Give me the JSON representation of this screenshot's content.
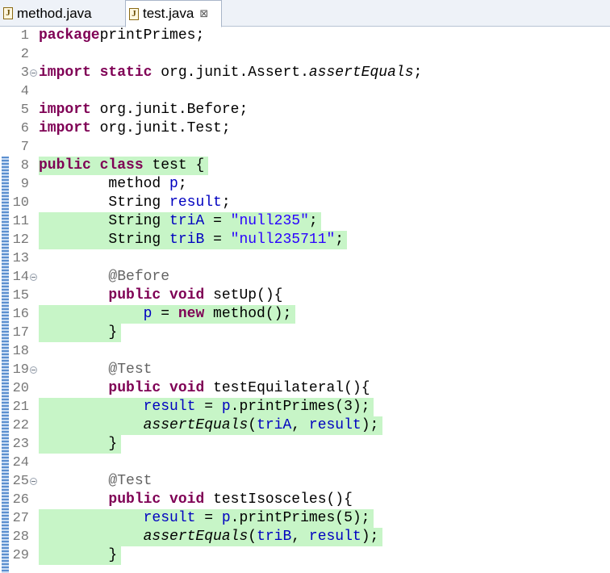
{
  "tabs": [
    {
      "label": "method.java",
      "active": false,
      "icon": "java-file-icon"
    },
    {
      "label": "test.java",
      "active": true,
      "icon": "java-file-icon"
    }
  ],
  "close_glyph": "⊠",
  "file_icon_glyph": "J",
  "colors": {
    "keyword": "#7f0055",
    "field": "#0000c0",
    "string": "#2a00ff",
    "annotation": "#646464",
    "covered_highlight": "#c7f5c7",
    "line_number": "#787878"
  },
  "code_lines": [
    {
      "n": "1",
      "indent": "",
      "fold": false,
      "covered": false,
      "tokens": [
        [
          "kw",
          "package"
        ],
        [
          "",
          "printPrimes;"
        ]
      ]
    },
    {
      "n": "2",
      "indent": "",
      "fold": false,
      "covered": false,
      "tokens": []
    },
    {
      "n": "3",
      "indent": "",
      "fold": true,
      "covered": false,
      "tokens": [
        [
          "kw",
          "import"
        ],
        [
          "",
          " "
        ],
        [
          "kw",
          "static"
        ],
        [
          "",
          " org.junit.Assert."
        ],
        [
          "st",
          "assertEquals"
        ],
        [
          "",
          ";"
        ]
      ]
    },
    {
      "n": "4",
      "indent": "",
      "fold": false,
      "covered": false,
      "tokens": []
    },
    {
      "n": "5",
      "indent": "",
      "fold": false,
      "covered": false,
      "tokens": [
        [
          "kw",
          "import"
        ],
        [
          "",
          " org.junit.Before;"
        ]
      ]
    },
    {
      "n": "6",
      "indent": "",
      "fold": false,
      "covered": false,
      "tokens": [
        [
          "kw",
          "import"
        ],
        [
          "",
          " org.junit.Test;"
        ]
      ]
    },
    {
      "n": "7",
      "indent": "",
      "fold": false,
      "covered": false,
      "tokens": []
    },
    {
      "n": "8",
      "indent": "",
      "fold": false,
      "covered": true,
      "tokens": [
        [
          "kw",
          "public"
        ],
        [
          "",
          " "
        ],
        [
          "kw",
          "class"
        ],
        [
          "",
          " test {"
        ]
      ]
    },
    {
      "n": "9",
      "indent": "        ",
      "fold": false,
      "covered": false,
      "tokens": [
        [
          "",
          "method "
        ],
        [
          "fld",
          "p"
        ],
        [
          "",
          ";"
        ]
      ]
    },
    {
      "n": "10",
      "indent": "        ",
      "fold": false,
      "covered": false,
      "tokens": [
        [
          "",
          "String "
        ],
        [
          "fld",
          "result"
        ],
        [
          "",
          ";"
        ]
      ]
    },
    {
      "n": "11",
      "indent": "        ",
      "fold": false,
      "covered": true,
      "tokens": [
        [
          "",
          "String "
        ],
        [
          "fld",
          "triA"
        ],
        [
          "",
          " = "
        ],
        [
          "str",
          "\"null235\""
        ],
        [
          "",
          ";"
        ]
      ]
    },
    {
      "n": "12",
      "indent": "        ",
      "fold": false,
      "covered": true,
      "tokens": [
        [
          "",
          "String "
        ],
        [
          "fld",
          "triB"
        ],
        [
          "",
          " = "
        ],
        [
          "str",
          "\"null235711\""
        ],
        [
          "",
          ";"
        ]
      ]
    },
    {
      "n": "13",
      "indent": "",
      "fold": false,
      "covered": false,
      "tokens": []
    },
    {
      "n": "14",
      "indent": "        ",
      "fold": true,
      "covered": false,
      "tokens": [
        [
          "ann",
          "@Before"
        ]
      ]
    },
    {
      "n": "15",
      "indent": "        ",
      "fold": false,
      "covered": false,
      "tokens": [
        [
          "kw",
          "public"
        ],
        [
          "",
          " "
        ],
        [
          "kw",
          "void"
        ],
        [
          "",
          " setUp(){"
        ]
      ]
    },
    {
      "n": "16",
      "indent": "            ",
      "fold": false,
      "covered": true,
      "tokens": [
        [
          "fld",
          "p"
        ],
        [
          "",
          " = "
        ],
        [
          "kw",
          "new"
        ],
        [
          "",
          " method();"
        ]
      ]
    },
    {
      "n": "17",
      "indent": "        ",
      "fold": false,
      "covered": true,
      "tokens": [
        [
          "",
          "}"
        ]
      ]
    },
    {
      "n": "18",
      "indent": "",
      "fold": false,
      "covered": false,
      "tokens": []
    },
    {
      "n": "19",
      "indent": "        ",
      "fold": true,
      "covered": false,
      "tokens": [
        [
          "ann",
          "@Test"
        ]
      ]
    },
    {
      "n": "20",
      "indent": "        ",
      "fold": false,
      "covered": false,
      "tokens": [
        [
          "kw",
          "public"
        ],
        [
          "",
          " "
        ],
        [
          "kw",
          "void"
        ],
        [
          "",
          " testEquilateral(){"
        ]
      ]
    },
    {
      "n": "21",
      "indent": "            ",
      "fold": false,
      "covered": true,
      "tokens": [
        [
          "fld",
          "result"
        ],
        [
          "",
          " = "
        ],
        [
          "fld",
          "p"
        ],
        [
          "",
          ".printPrimes(3);"
        ]
      ]
    },
    {
      "n": "22",
      "indent": "            ",
      "fold": false,
      "covered": true,
      "tokens": [
        [
          "st",
          "assertEquals"
        ],
        [
          "",
          "("
        ],
        [
          "fld",
          "triA"
        ],
        [
          "",
          ", "
        ],
        [
          "fld",
          "result"
        ],
        [
          "",
          ");"
        ]
      ]
    },
    {
      "n": "23",
      "indent": "        ",
      "fold": false,
      "covered": true,
      "tokens": [
        [
          "",
          "}"
        ]
      ]
    },
    {
      "n": "24",
      "indent": "",
      "fold": false,
      "covered": false,
      "tokens": []
    },
    {
      "n": "25",
      "indent": "        ",
      "fold": true,
      "covered": false,
      "tokens": [
        [
          "ann",
          "@Test"
        ]
      ]
    },
    {
      "n": "26",
      "indent": "        ",
      "fold": false,
      "covered": false,
      "tokens": [
        [
          "kw",
          "public"
        ],
        [
          "",
          " "
        ],
        [
          "kw",
          "void"
        ],
        [
          "",
          " testIsosceles(){"
        ]
      ]
    },
    {
      "n": "27",
      "indent": "            ",
      "fold": false,
      "covered": true,
      "tokens": [
        [
          "fld",
          "result"
        ],
        [
          "",
          " = "
        ],
        [
          "fld",
          "p"
        ],
        [
          "",
          ".printPrimes(5);"
        ]
      ]
    },
    {
      "n": "28",
      "indent": "            ",
      "fold": false,
      "covered": true,
      "tokens": [
        [
          "st",
          "assertEquals"
        ],
        [
          "",
          "("
        ],
        [
          "fld",
          "triB"
        ],
        [
          "",
          ", "
        ],
        [
          "fld",
          "result"
        ],
        [
          "",
          ");"
        ]
      ]
    },
    {
      "n": "29",
      "indent": "        ",
      "fold": false,
      "covered": true,
      "tokens": [
        [
          "",
          "}"
        ]
      ]
    }
  ]
}
